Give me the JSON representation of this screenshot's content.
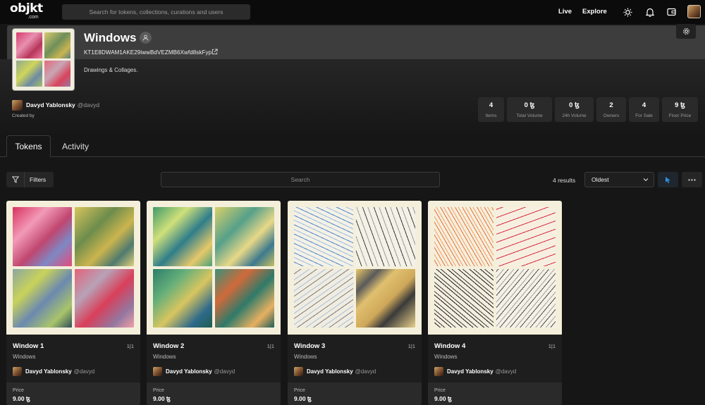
{
  "nav": {
    "logo_main": "objkt",
    "logo_sub": ".com",
    "search_placeholder": "Search for tokens, collections, curations and users",
    "links": [
      "Live",
      "Explore"
    ],
    "icons": [
      "sun-icon",
      "bell-icon",
      "wallet-icon"
    ]
  },
  "collection": {
    "title": "Windows",
    "contract": "KT1E8DWAM1AKE29iwwBdVEZMB6Xwfd8skFyp",
    "description": "Drawings & Collages.",
    "creator_name": "Davyd Yablonsky",
    "creator_handle": "@davyd",
    "created_by_label": "Created by"
  },
  "stats": [
    {
      "value": "4",
      "label": "Items"
    },
    {
      "value": "0 ꜩ",
      "label": "Total Volume"
    },
    {
      "value": "0 ꜩ",
      "label": "24h Volume"
    },
    {
      "value": "2",
      "label": "Owners"
    },
    {
      "value": "4",
      "label": "For Sale"
    },
    {
      "value": "9 ꜩ",
      "label": "Floor Price"
    }
  ],
  "tabs": [
    "Tokens",
    "Activity"
  ],
  "toolbar": {
    "filters_label": "Filters",
    "search_placeholder": "Search",
    "results": "4 results",
    "sort_value": "Oldest"
  },
  "tokens": [
    {
      "name": "Window 1",
      "edition": "1|1",
      "collection": "Windows",
      "creator_name": "Davyd Yablonsky",
      "creator_handle": "@davyd",
      "price_label": "Price",
      "price": "9.00 ꜩ"
    },
    {
      "name": "Window 2",
      "edition": "1|1",
      "collection": "Windows",
      "creator_name": "Davyd Yablonsky",
      "creator_handle": "@davyd",
      "price_label": "Price",
      "price": "9.00 ꜩ"
    },
    {
      "name": "Window 3",
      "edition": "1|1",
      "collection": "Windows",
      "creator_name": "Davyd Yablonsky",
      "creator_handle": "@davyd",
      "price_label": "Price",
      "price": "9.00 ꜩ"
    },
    {
      "name": "Window 4",
      "edition": "1|1",
      "collection": "Windows",
      "creator_name": "Davyd Yablonsky",
      "creator_handle": "@davyd",
      "price_label": "Price",
      "price": "9.00 ꜩ"
    }
  ],
  "colors": {
    "background": "#161616",
    "nav": "#0b0b0b",
    "card": "#1e1e1e",
    "accent_blue": "#2f8fd8",
    "paper": "#f4efdb"
  }
}
